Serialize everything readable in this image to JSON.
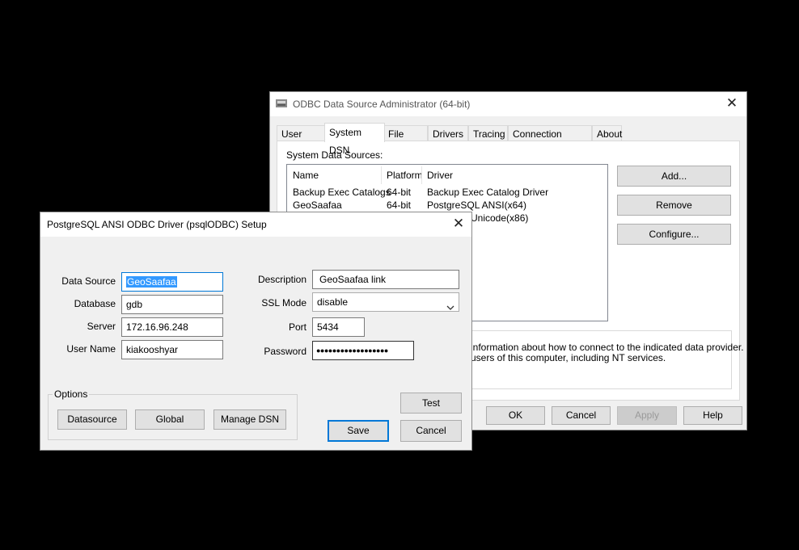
{
  "odbc_admin": {
    "title": "ODBC Data Source Administrator (64-bit)",
    "tabs": [
      "User DSN",
      "System DSN",
      "File DSN",
      "Drivers",
      "Tracing",
      "Connection Pooling",
      "About"
    ],
    "active_tab": "System DSN",
    "section_label": "System Data Sources:",
    "columns": [
      "Name",
      "Platform",
      "Driver"
    ],
    "rows": [
      {
        "name": "Backup Exec Catalogs",
        "platform": "64-bit",
        "driver": "Backup Exec Catalog Driver"
      },
      {
        "name": "GeoSaafaa",
        "platform": "64-bit",
        "driver": "PostgreSQL ANSI(x64)"
      },
      {
        "name": "",
        "platform": "",
        "driver": "Unicode(x86)"
      }
    ],
    "side_buttons": {
      "add": "Add...",
      "remove": "Remove",
      "configure": "Configure..."
    },
    "info_lines": [
      "information about how to connect to the indicated data provider.",
      "users of this computer, including NT services."
    ],
    "footer_buttons": {
      "ok": "OK",
      "cancel": "Cancel",
      "apply": "Apply",
      "help": "Help"
    }
  },
  "setup_dialog": {
    "title": "PostgreSQL ANSI ODBC Driver (psqlODBC) Setup",
    "labels": {
      "data_source": "Data Source",
      "database": "Database",
      "server": "Server",
      "user_name": "User Name",
      "description": "Description",
      "ssl_mode": "SSL Mode",
      "port": "Port",
      "password": "Password"
    },
    "values": {
      "data_source": "GeoSaafaa",
      "database": "gdb",
      "server": "172.16.96.248",
      "user_name": "kiakooshyar",
      "description": "GeoSaafaa link",
      "ssl_mode": "disable",
      "port": "5434",
      "password": "●●●●●●●●●●●●●●●●●●"
    },
    "options_label": "Options",
    "option_buttons": {
      "datasource": "Datasource",
      "global": "Global",
      "manage_dsn": "Manage DSN"
    },
    "buttons": {
      "test": "Test",
      "save": "Save",
      "cancel": "Cancel"
    }
  },
  "colors": {
    "accent": "#0078d7",
    "selection": "#3399ff",
    "background": "#000000"
  }
}
